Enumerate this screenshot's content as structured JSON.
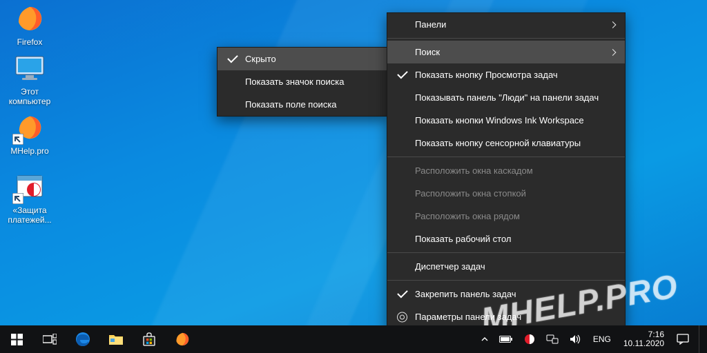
{
  "desktop": {
    "icons": [
      {
        "name": "firefox",
        "label": "Firefox"
      },
      {
        "name": "this-pc",
        "label": "Этот\nкомпьютер"
      },
      {
        "name": "mhelp",
        "label": "MHelp.pro"
      },
      {
        "name": "payments",
        "label": "«Защита\nплатежей..."
      }
    ]
  },
  "submenu": {
    "items": [
      {
        "label": "Скрыто",
        "checked": true,
        "hover": true
      },
      {
        "label": "Показать значок поиска"
      },
      {
        "label": "Показать поле поиска"
      }
    ]
  },
  "menu": {
    "items": [
      {
        "label": "Панели",
        "submenu": true
      },
      {
        "sep": true
      },
      {
        "label": "Поиск",
        "submenu": true,
        "hover": true
      },
      {
        "label": "Показать кнопку Просмотра задач",
        "checked": true
      },
      {
        "label": "Показывать панель \"Люди\" на панели задач"
      },
      {
        "label": "Показать кнопки Windows Ink Workspace"
      },
      {
        "label": "Показать кнопку сенсорной клавиатуры"
      },
      {
        "sep": true
      },
      {
        "label": "Расположить окна каскадом",
        "disabled": true
      },
      {
        "label": "Расположить окна стопкой",
        "disabled": true
      },
      {
        "label": "Расположить окна рядом",
        "disabled": true
      },
      {
        "label": "Показать рабочий стол"
      },
      {
        "sep": true
      },
      {
        "label": "Диспетчер задач"
      },
      {
        "sep": true
      },
      {
        "label": "Закрепить панель задач",
        "checked": true
      },
      {
        "label": "Параметры панели задач",
        "gear": true
      }
    ]
  },
  "tray": {
    "lang": "ENG",
    "time": "7:16",
    "date": "10.11.2020"
  },
  "watermark": "MHELP.PRO"
}
